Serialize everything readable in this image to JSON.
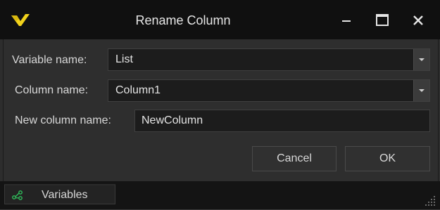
{
  "window": {
    "title": "Rename Column",
    "controls": [
      "minimize-icon",
      "maximize-icon",
      "close-icon"
    ],
    "logo": "app-logo-icon"
  },
  "form": {
    "variable_name": {
      "label": "Variable name:",
      "value": "List"
    },
    "column_name": {
      "label": "Column name:",
      "value": "Column1"
    },
    "new_column_name": {
      "label": "New column name:",
      "value": "NewColumn"
    }
  },
  "buttons": {
    "cancel": "Cancel",
    "ok": "OK"
  },
  "bottom_panel": {
    "tab_label": "Variables",
    "tab_icon": "variables-icon"
  },
  "colors": {
    "titlebar": "#101010",
    "panel": "#2e2e2e",
    "input_bg": "#1c1c1c",
    "logo_yellow": "#f2d21b",
    "variables_icon_green": "#2fbf5b"
  }
}
